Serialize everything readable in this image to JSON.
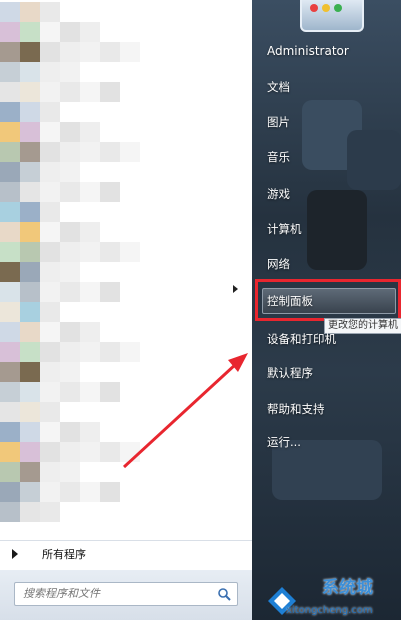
{
  "user": {
    "name": "Administrator"
  },
  "right_menu": {
    "documents": "文档",
    "pictures": "图片",
    "music": "音乐",
    "games": "游戏",
    "computer": "计算机",
    "network": "网络",
    "control_panel": "控制面板",
    "devices_printers": "设备和打印机",
    "default_programs": "默认程序",
    "help_support": "帮助和支持",
    "run": "运行..."
  },
  "tooltip": "更改您的计算机",
  "left_pane": {
    "all_programs": "所有程序"
  },
  "search": {
    "placeholder": "搜索程序和文件"
  },
  "watermark": {
    "brand": "系统城",
    "url": "xitongcheng.com"
  },
  "colors": {
    "highlight": "#e8262f",
    "arrow": "#e8262f"
  }
}
